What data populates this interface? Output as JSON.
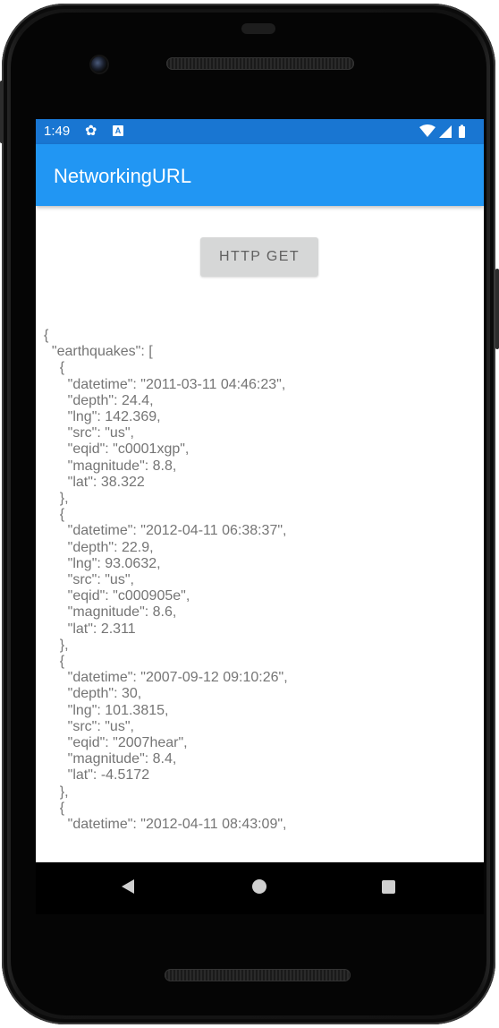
{
  "status_bar": {
    "time": "1:49",
    "notification_letter": "A",
    "icons": [
      "gear-icon",
      "notification-a-icon",
      "wifi-icon",
      "signal-icon",
      "battery-icon"
    ]
  },
  "app_bar": {
    "title": "NetworkingURL",
    "color": "#2196f3",
    "status_color": "#1976d2"
  },
  "main": {
    "http_button_label": "HTTP GET",
    "json_text": "{\n  \"earthquakes\": [\n    {\n      \"datetime\": \"2011-03-11 04:46:23\",\n      \"depth\": 24.4,\n      \"lng\": 142.369,\n      \"src\": \"us\",\n      \"eqid\": \"c0001xgp\",\n      \"magnitude\": 8.8,\n      \"lat\": 38.322\n    },\n    {\n      \"datetime\": \"2012-04-11 06:38:37\",\n      \"depth\": 22.9,\n      \"lng\": 93.0632,\n      \"src\": \"us\",\n      \"eqid\": \"c000905e\",\n      \"magnitude\": 8.6,\n      \"lat\": 2.311\n    },\n    {\n      \"datetime\": \"2007-09-12 09:10:26\",\n      \"depth\": 30,\n      \"lng\": 101.3815,\n      \"src\": \"us\",\n      \"eqid\": \"2007hear\",\n      \"magnitude\": 8.4,\n      \"lat\": -4.5172\n    },\n    {\n      \"datetime\": \"2012-04-11 08:43:09\","
  },
  "nav_bar": {
    "icons": [
      "back-icon",
      "home-icon",
      "recents-icon"
    ]
  }
}
